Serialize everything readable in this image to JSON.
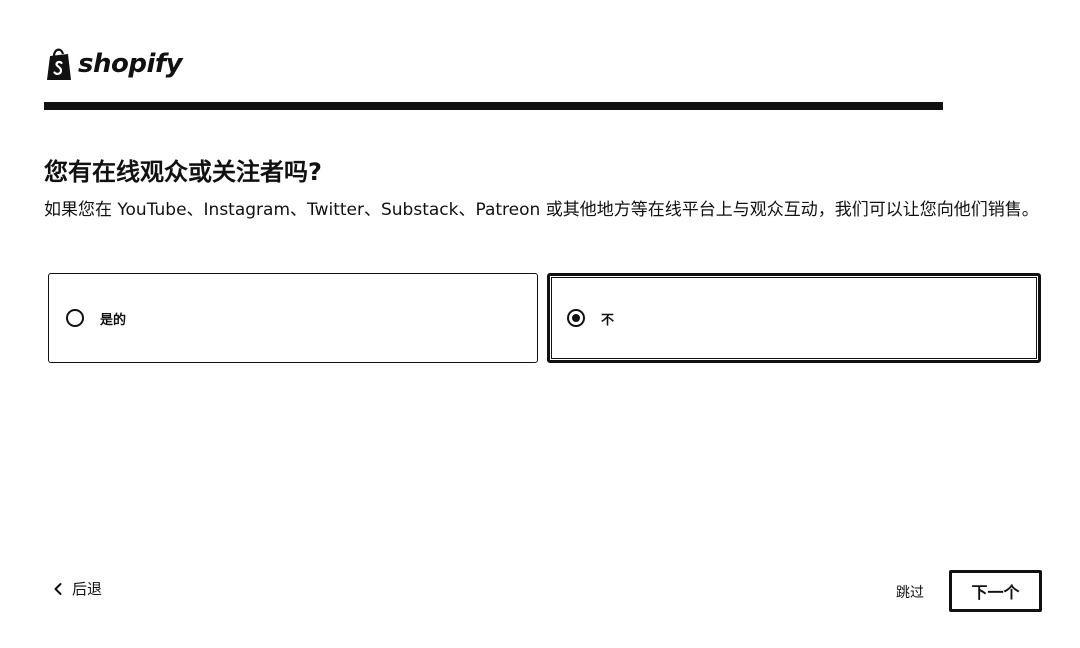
{
  "brand": {
    "name": "shopify",
    "logo_icon": "shopify-bag-icon"
  },
  "progress": {
    "fraction": 1.0
  },
  "question": {
    "title": "您有在线观众或关注者吗?",
    "description": "如果您在 YouTube、Instagram、Twitter、Substack、Patreon 或其他地方等在线平台上与观众互动，我们可以让您向他们销售。"
  },
  "options": [
    {
      "label": "是的",
      "selected": false
    },
    {
      "label": "不",
      "selected": true
    }
  ],
  "footer": {
    "back_label": "后退",
    "back_icon": "chevron-left-icon",
    "skip_label": "跳过",
    "next_label": "下一个"
  },
  "colors": {
    "primary": "#111111",
    "track": "#e6e6e6",
    "background": "#ffffff"
  }
}
